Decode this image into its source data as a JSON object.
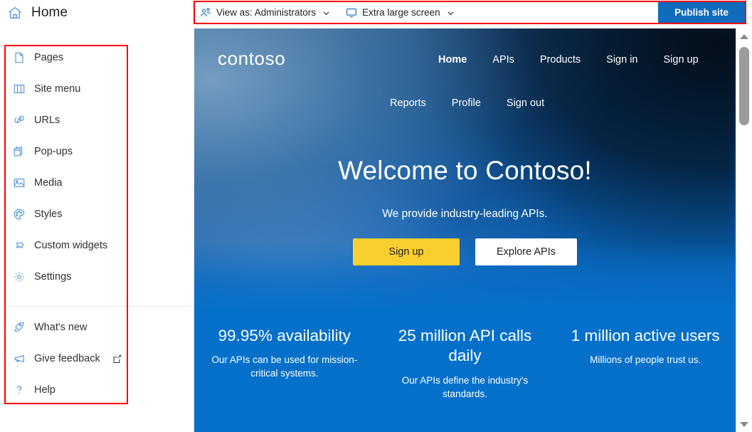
{
  "app": {
    "home_label": "Home",
    "home_icon": "home-icon"
  },
  "sidebar": {
    "primary_items": [
      {
        "label": "Pages",
        "icon": "page-document-icon"
      },
      {
        "label": "Site menu",
        "icon": "book-open-icon"
      },
      {
        "label": "URLs",
        "icon": "link-chain-icon"
      },
      {
        "label": "Pop-ups",
        "icon": "copy-windows-icon"
      },
      {
        "label": "Media",
        "icon": "image-picture-icon"
      },
      {
        "label": "Styles",
        "icon": "paint-palette-icon"
      },
      {
        "label": "Custom widgets",
        "icon": "puzzle-piece-icon"
      },
      {
        "label": "Settings",
        "icon": "gear-icon"
      }
    ],
    "secondary_items": [
      {
        "label": "What's new",
        "icon": "rocket-icon",
        "external": false
      },
      {
        "label": "Give feedback",
        "icon": "megaphone-icon",
        "external": true
      },
      {
        "label": "Help",
        "icon": "question-mark-icon",
        "external": false
      }
    ]
  },
  "toolbar": {
    "view_as": {
      "label": "View as: Administrators",
      "icon": "contact-person-icon",
      "chevron": "chevron-down-icon"
    },
    "screen_size": {
      "label": "Extra large screen",
      "icon": "monitor-screen-icon",
      "chevron": "chevron-down-icon"
    },
    "publish_label": "Publish site",
    "publish_color": "#0f6cbd"
  },
  "preview": {
    "brand": "contoso",
    "nav_row_1": [
      {
        "label": "Home",
        "active": true
      },
      {
        "label": "APIs",
        "active": false
      },
      {
        "label": "Products",
        "active": false
      },
      {
        "label": "Sign in",
        "active": false
      },
      {
        "label": "Sign up",
        "active": false
      }
    ],
    "nav_row_2": [
      {
        "label": "Reports",
        "active": false
      },
      {
        "label": "Profile",
        "active": false
      },
      {
        "label": "Sign out",
        "active": false
      }
    ],
    "hero": {
      "title": "Welcome to Contoso!",
      "subtitle": "We provide industry-leading APIs.",
      "primary_button": "Sign up",
      "primary_button_color": "#f8cf2f",
      "secondary_button": "Explore APIs",
      "secondary_button_color": "#ffffff"
    },
    "stats": [
      {
        "value": "99.95% availability",
        "description": "Our APIs can be used for mission-critical systems."
      },
      {
        "value": "25 million API calls daily",
        "description": "Our APIs define the industry's standards."
      },
      {
        "value": "1 million active users",
        "description": "Millions of people trust us."
      }
    ],
    "band_color": "#0570c9"
  },
  "scrollbar": {
    "up_icon": "scroll-up-arrow-icon",
    "down_icon": "scroll-down-arrow-icon",
    "thumb": "scroll-thumb"
  },
  "highlights": {
    "color": "#ff0000"
  }
}
